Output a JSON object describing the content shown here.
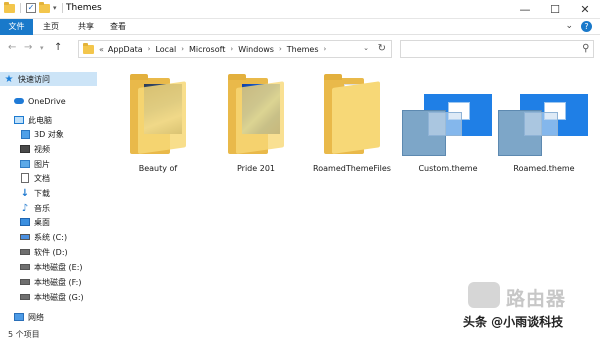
{
  "window": {
    "title": "Themes",
    "minimize": "—",
    "maximize": "☐",
    "close": "✕"
  },
  "ribbon": {
    "tabs": [
      "文件",
      "主页",
      "共享",
      "查看"
    ],
    "expand": "⌄"
  },
  "address": {
    "prefix": "«",
    "crumbs": [
      "AppData",
      "Local",
      "Microsoft",
      "Windows",
      "Themes"
    ],
    "search_placeholder": ""
  },
  "sidebar": {
    "items": [
      {
        "label": "快速访问",
        "icon": "star-icon"
      },
      {
        "label": "OneDrive",
        "icon": "cloud-icon"
      },
      {
        "label": "此电脑",
        "icon": "pc-icon"
      },
      {
        "label": "3D 对象",
        "icon": "3d-objects-icon"
      },
      {
        "label": "视频",
        "icon": "video-icon"
      },
      {
        "label": "图片",
        "icon": "pictures-icon"
      },
      {
        "label": "文档",
        "icon": "documents-icon"
      },
      {
        "label": "下载",
        "icon": "download-icon"
      },
      {
        "label": "音乐",
        "icon": "music-icon"
      },
      {
        "label": "桌面",
        "icon": "desktop-icon"
      },
      {
        "label": "系统 (C:)",
        "icon": "drive-icon"
      },
      {
        "label": "软件 (D:)",
        "icon": "drive-icon"
      },
      {
        "label": "本地磁盘 (E:)",
        "icon": "drive-icon"
      },
      {
        "label": "本地磁盘 (F:)",
        "icon": "drive-icon"
      },
      {
        "label": "本地磁盘 (G:)",
        "icon": "drive-icon"
      },
      {
        "label": "网络",
        "icon": "network-icon"
      }
    ]
  },
  "files": [
    {
      "name": "Beauty of",
      "type": "folder"
    },
    {
      "name": "Pride 201",
      "type": "folder"
    },
    {
      "name": "RoamedThemeFiles",
      "type": "folder"
    },
    {
      "name": "Custom.theme",
      "type": "theme"
    },
    {
      "name": "Roamed.theme",
      "type": "theme"
    }
  ],
  "status": {
    "count": "5 个项目"
  },
  "watermark": {
    "brand": "路由器",
    "credit": "头条 @小雨谈科技"
  },
  "colors": {
    "accent": "#1979ca",
    "selected": "#cce4f7",
    "folder": "#f7d877"
  }
}
